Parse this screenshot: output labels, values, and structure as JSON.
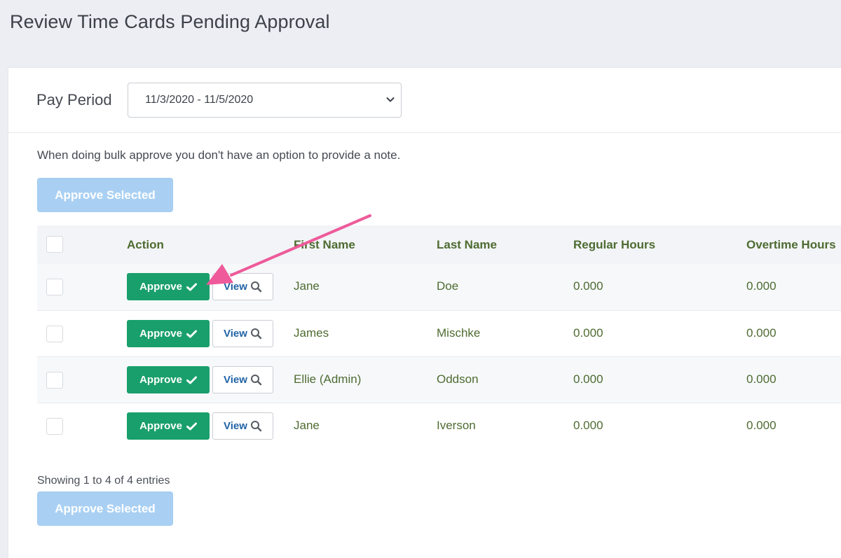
{
  "page": {
    "title": "Review Time Cards Pending Approval"
  },
  "pay_period": {
    "label": "Pay Period",
    "selected": "11/3/2020 - 11/5/2020"
  },
  "bulk": {
    "note": "When doing bulk approve you don't have an option to provide a note.",
    "approve_selected_label": "Approve Selected"
  },
  "table": {
    "headers": {
      "action": "Action",
      "first_name": "First Name",
      "last_name": "Last Name",
      "regular_hours": "Regular Hours",
      "overtime_hours": "Overtime Hours"
    },
    "approve_label": "Approve",
    "view_label": "View",
    "rows": [
      {
        "first_name": "Jane",
        "last_name": "Doe",
        "regular_hours": "0.000",
        "overtime_hours": "0.000"
      },
      {
        "first_name": "James",
        "last_name": "Mischke",
        "regular_hours": "0.000",
        "overtime_hours": "0.000"
      },
      {
        "first_name": "Ellie (Admin)",
        "last_name": "Oddson",
        "regular_hours": "0.000",
        "overtime_hours": "0.000"
      },
      {
        "first_name": "Jane",
        "last_name": "Iverson",
        "regular_hours": "0.000",
        "overtime_hours": "0.000"
      }
    ]
  },
  "footer": {
    "entries_text": "Showing 1 to 4 of 4 entries"
  },
  "colors": {
    "approve_green": "#199f6b",
    "header_text_green": "#4e6b31",
    "view_blue": "#2163a8",
    "disabled_blue": "#a9d0f3",
    "annotation_pink": "#ee5a9a"
  },
  "icons": {
    "approve": "checkmark-icon",
    "view": "magnifier-icon",
    "select": "chevron-down-icon",
    "annotation": "pointer-arrow"
  }
}
